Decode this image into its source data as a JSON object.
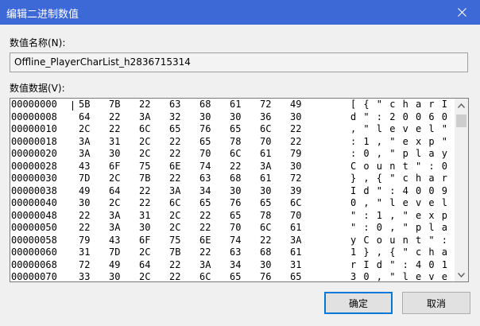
{
  "window": {
    "title": "编辑二进制数值"
  },
  "name_field": {
    "label": "数值名称(N):",
    "value": "Offline_PlayerCharList_h2836715314"
  },
  "data_field": {
    "label": "数值数据(V):",
    "rows": [
      {
        "addr": "00000000",
        "bytes": [
          "5B",
          "7B",
          "22",
          "63",
          "68",
          "61",
          "72",
          "49"
        ],
        "chars": [
          "[",
          "{",
          "\"",
          "c",
          "h",
          "a",
          "r",
          "I"
        ]
      },
      {
        "addr": "00000008",
        "bytes": [
          "64",
          "22",
          "3A",
          "32",
          "30",
          "30",
          "36",
          "30"
        ],
        "chars": [
          "d",
          "\"",
          ":",
          "2",
          "0",
          "0",
          "6",
          "0"
        ]
      },
      {
        "addr": "00000010",
        "bytes": [
          "2C",
          "22",
          "6C",
          "65",
          "76",
          "65",
          "6C",
          "22"
        ],
        "chars": [
          ",",
          "\"",
          "l",
          "e",
          "v",
          "e",
          "l",
          "\""
        ]
      },
      {
        "addr": "00000018",
        "bytes": [
          "3A",
          "31",
          "2C",
          "22",
          "65",
          "78",
          "70",
          "22"
        ],
        "chars": [
          ":",
          "1",
          ",",
          "\"",
          "e",
          "x",
          "p",
          "\""
        ]
      },
      {
        "addr": "00000020",
        "bytes": [
          "3A",
          "30",
          "2C",
          "22",
          "70",
          "6C",
          "61",
          "79"
        ],
        "chars": [
          ":",
          "0",
          ",",
          "\"",
          "p",
          "l",
          "a",
          "y"
        ]
      },
      {
        "addr": "00000028",
        "bytes": [
          "43",
          "6F",
          "75",
          "6E",
          "74",
          "22",
          "3A",
          "30"
        ],
        "chars": [
          "C",
          "o",
          "u",
          "n",
          "t",
          "\"",
          ":",
          "0"
        ]
      },
      {
        "addr": "00000030",
        "bytes": [
          "7D",
          "2C",
          "7B",
          "22",
          "63",
          "68",
          "61",
          "72"
        ],
        "chars": [
          "}",
          ",",
          "{",
          "\"",
          "c",
          "h",
          "a",
          "r"
        ]
      },
      {
        "addr": "00000038",
        "bytes": [
          "49",
          "64",
          "22",
          "3A",
          "34",
          "30",
          "30",
          "39"
        ],
        "chars": [
          "I",
          "d",
          "\"",
          ":",
          "4",
          "0",
          "0",
          "9"
        ]
      },
      {
        "addr": "00000040",
        "bytes": [
          "30",
          "2C",
          "22",
          "6C",
          "65",
          "76",
          "65",
          "6C"
        ],
        "chars": [
          "0",
          ",",
          "\"",
          "l",
          "e",
          "v",
          "e",
          "l"
        ]
      },
      {
        "addr": "00000048",
        "bytes": [
          "22",
          "3A",
          "31",
          "2C",
          "22",
          "65",
          "78",
          "70"
        ],
        "chars": [
          "\"",
          ":",
          "1",
          ",",
          "\"",
          "e",
          "x",
          "p"
        ]
      },
      {
        "addr": "00000050",
        "bytes": [
          "22",
          "3A",
          "30",
          "2C",
          "22",
          "70",
          "6C",
          "61"
        ],
        "chars": [
          "\"",
          ":",
          "0",
          ",",
          "\"",
          "p",
          "l",
          "a"
        ]
      },
      {
        "addr": "00000058",
        "bytes": [
          "79",
          "43",
          "6F",
          "75",
          "6E",
          "74",
          "22",
          "3A"
        ],
        "chars": [
          "y",
          "C",
          "o",
          "u",
          "n",
          "t",
          "\"",
          ":"
        ]
      },
      {
        "addr": "00000060",
        "bytes": [
          "31",
          "7D",
          "2C",
          "7B",
          "22",
          "63",
          "68",
          "61"
        ],
        "chars": [
          "1",
          "}",
          ",",
          "{",
          "\"",
          "c",
          "h",
          "a"
        ]
      },
      {
        "addr": "00000068",
        "bytes": [
          "72",
          "49",
          "64",
          "22",
          "3A",
          "34",
          "30",
          "31"
        ],
        "chars": [
          "r",
          "I",
          "d",
          "\"",
          ":",
          "4",
          "0",
          "1"
        ]
      },
      {
        "addr": "00000070",
        "bytes": [
          "33",
          "30",
          "2C",
          "22",
          "6C",
          "65",
          "76",
          "65"
        ],
        "chars": [
          "3",
          "0",
          ",",
          "\"",
          "l",
          "e",
          "v",
          "e"
        ]
      }
    ]
  },
  "buttons": {
    "ok": "确定",
    "cancel": "取消"
  },
  "colors": {
    "titlebar": "#3d69d7",
    "focus": "#0078d7"
  }
}
